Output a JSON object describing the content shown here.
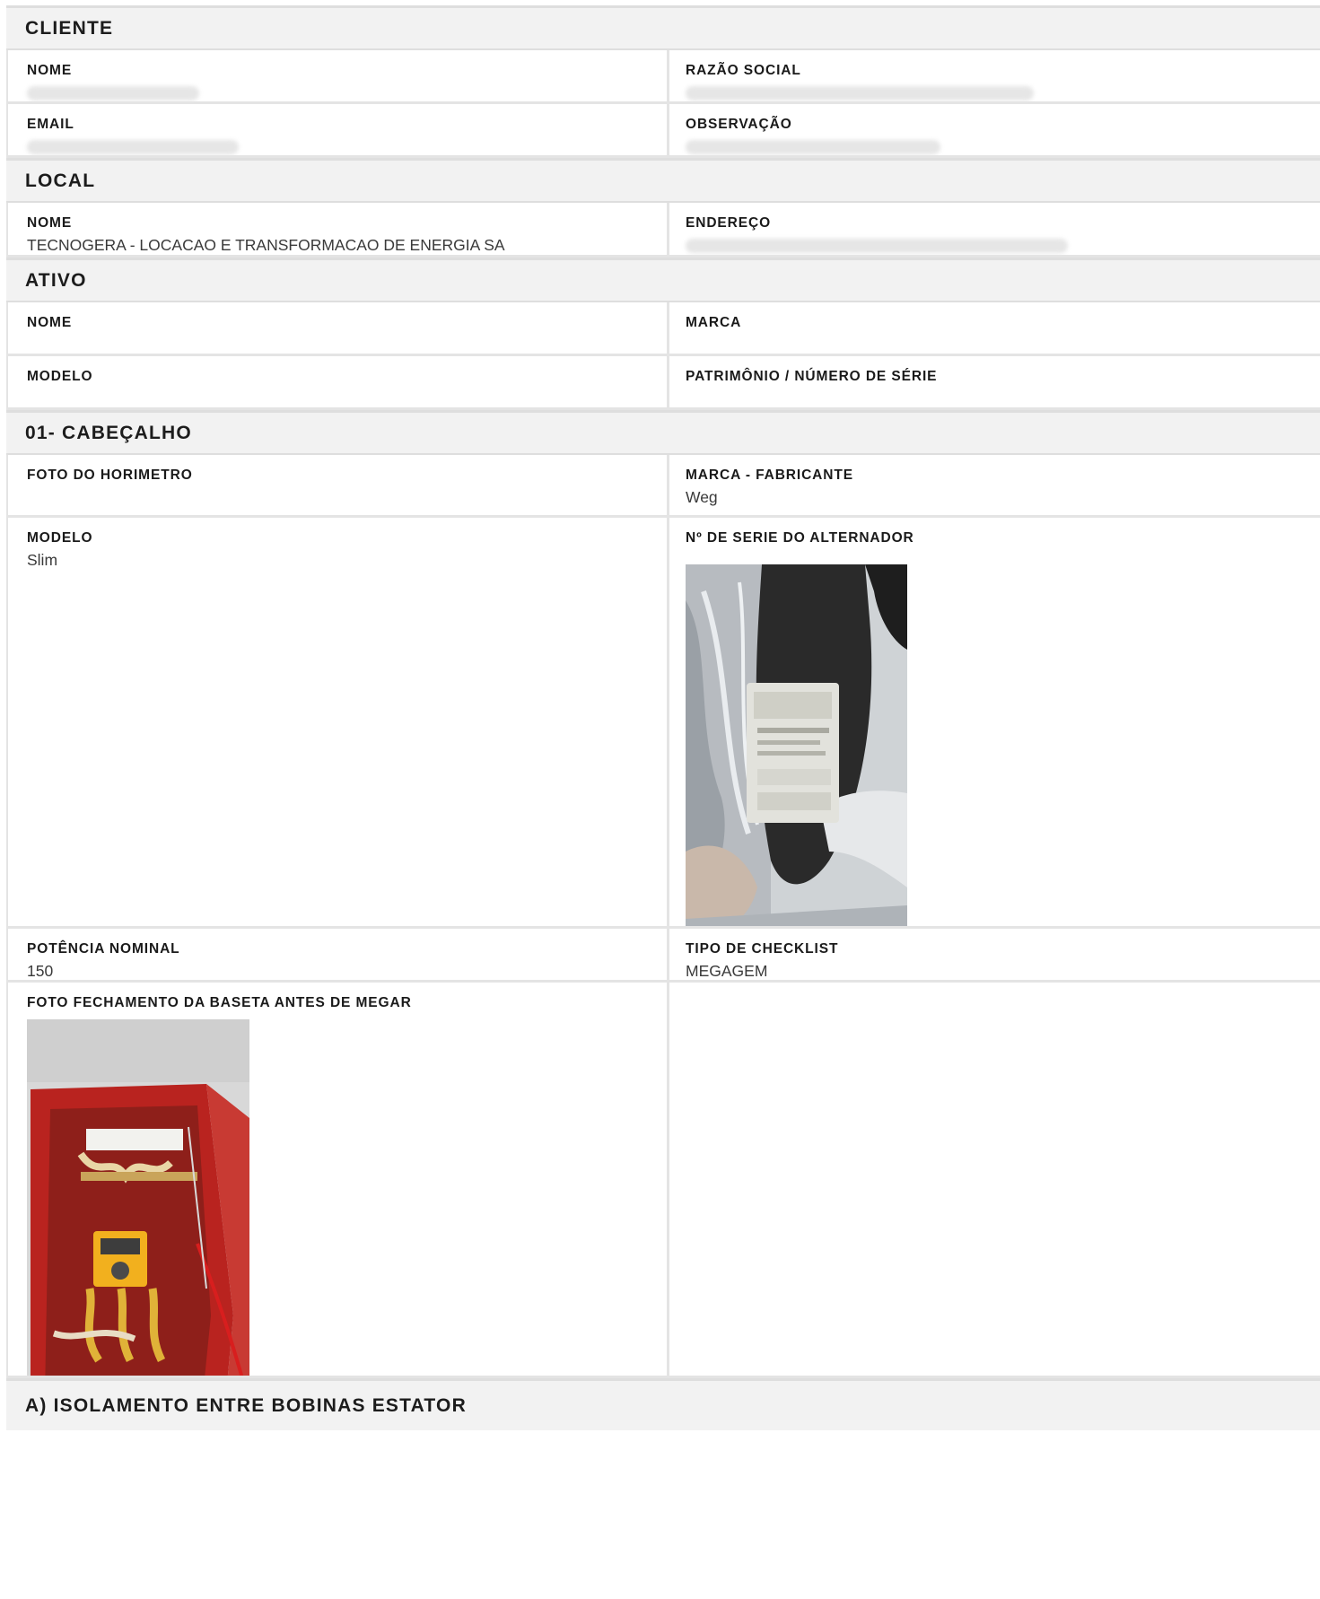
{
  "cliente": {
    "title": "CLIENTE",
    "nome_label": "NOME",
    "razao_label": "RAZÃO SOCIAL",
    "email_label": "EMAIL",
    "obs_label": "OBSERVAÇÃO"
  },
  "local": {
    "title": "LOCAL",
    "nome_label": "NOME",
    "nome_value": "TECNOGERA - LOCACAO E TRANSFORMACAO DE ENERGIA SA",
    "endereco_label": "ENDEREÇO"
  },
  "ativo": {
    "title": "ATIVO",
    "nome_label": "NOME",
    "marca_label": "MARCA",
    "modelo_label": "MODELO",
    "patrimonio_label": "PATRIMÔNIO / NÚMERO DE SÉRIE"
  },
  "cabecalho": {
    "title": "01- CABEÇALHO",
    "foto_horimetro_label": "FOTO DO HORIMETRO",
    "marca_label": "MARCA - FABRICANTE",
    "marca_value": "Weg",
    "modelo_label": "MODELO",
    "modelo_value": "Slim",
    "serie_label": "Nº DE SERIE DO ALTERNADOR",
    "potencia_label": "POTÊNCIA NOMINAL",
    "potencia_value": "150",
    "tipo_label": "TIPO DE CHECKLIST",
    "tipo_value": "MEGAGEM",
    "foto_baseta_label": "FOTO FECHAMENTO DA BASETA ANTES DE MEGAR"
  },
  "isolamento": {
    "title": "A) ISOLAMENTO ENTRE BOBINAS ESTATOR"
  }
}
